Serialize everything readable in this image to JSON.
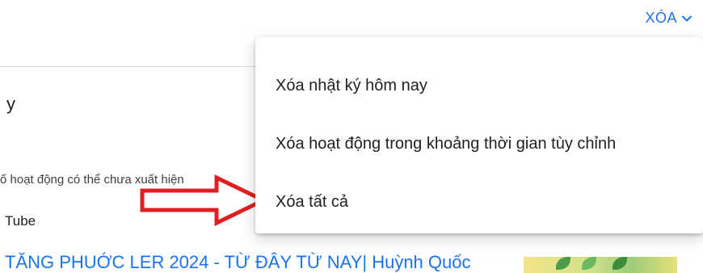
{
  "header": {
    "delete_label": "XÓA"
  },
  "page": {
    "partial_heading": "y",
    "notice": "ố hoạt động có thể chưa xuất hiện",
    "service": "Tube",
    "video_title": " TĂNG PHUỚC LER 2024 - TỪ ĐÂY TỪ NAY| Huỳnh Quốc"
  },
  "menu": {
    "items": [
      {
        "label": "Xóa nhật ký hôm nay"
      },
      {
        "label": "Xóa hoạt động trong khoảng thời gian tùy chỉnh"
      },
      {
        "label": "Xóa tất cả"
      }
    ]
  },
  "colors": {
    "accent": "#1a73e8",
    "annotation": "#e02020"
  },
  "icons": {
    "trigger": "chevron-down-icon"
  }
}
